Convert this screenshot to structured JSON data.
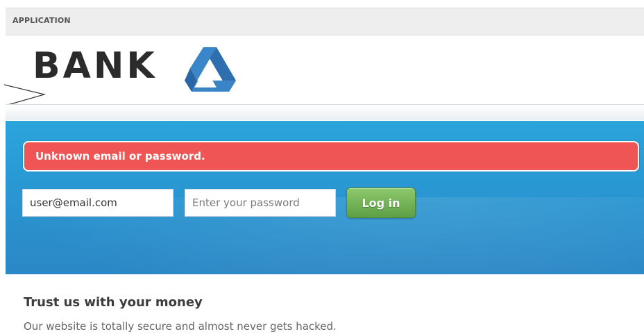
{
  "header": {
    "label": "APPLICATION"
  },
  "brand": {
    "name": "BANK",
    "mark_icon": "triangle-logo-icon"
  },
  "hero": {
    "error_message": "Unknown email or password.",
    "email_value": "user@email.com",
    "password_placeholder": "Enter your password",
    "login_label": "Log in"
  },
  "content": {
    "title": "Trust us with your money",
    "body": "Our website is totally secure and almost never gets hacked."
  },
  "colors": {
    "hero_blue": "#2a97d2",
    "error_red": "#f05555",
    "login_green": "#6aad4f"
  }
}
